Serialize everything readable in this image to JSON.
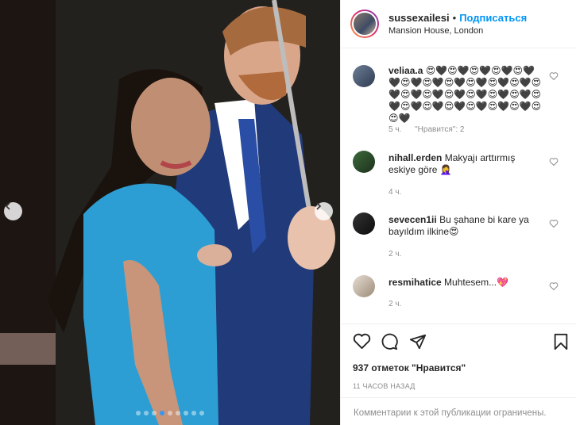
{
  "post": {
    "username": "sussexailesi",
    "separator": "•",
    "follow_label": "Подписаться",
    "location": "Mansion House, London",
    "carousel": {
      "count": 9,
      "active": 3
    }
  },
  "comments": [
    {
      "user": "veliaa.a",
      "text": "😍🖤😍🖤😍🖤😍🖤😍🖤🖤😍🖤😍🖤😍🖤😍🖤😍🖤😍🖤😍🖤😍🖤😍🖤😍🖤😍🖤😍🖤😍🖤😍🖤😍🖤😍🖤😍🖤😍🖤😍🖤😍🖤😍😍🖤",
      "age": "5 ч.",
      "likes": "\"Нравится\": 2"
    },
    {
      "user": "nihall.erden",
      "text": "Makyajı arttırmış eskiye göre 🤦‍♀",
      "age": "4 ч."
    },
    {
      "user": "sevecen1ii",
      "text": "Bu şahane bi kare ya bayıldım ilkine😍",
      "age": "2 ч."
    },
    {
      "user": "resmihatice",
      "text": "Muhtesem...💖",
      "age": "2 ч."
    }
  ],
  "footer": {
    "likes_count": "937 отметок \"Нравится\"",
    "time": "11 ЧАСОВ НАЗАД",
    "comments_limited": "Комментарии к этой публикации ограничены."
  }
}
